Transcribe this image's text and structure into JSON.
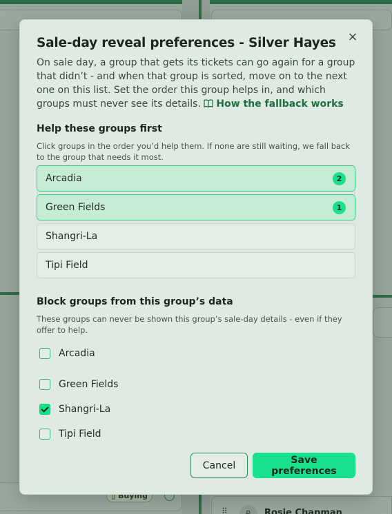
{
  "background": {
    "badge_label": "Buying",
    "person_initial": "R",
    "person_name": "Rosie Chapman"
  },
  "modal": {
    "title": "Sale-day reveal preferences - Silver Hayes",
    "close_label": "×",
    "intro": "On sale day, a group that gets its tickets can go again for a group that didn’t - and when that group is sorted, move on to the next one on this list. Set the order this group helps in, and which groups must never see its details.",
    "intro_link": "How the fallback works"
  },
  "help_section": {
    "title": "Help these groups first",
    "help": "Click groups in the order you’d help them. If none are still waiting, we fall back to the group that needs it most.",
    "options": [
      {
        "label": "Arcadia",
        "selected": true,
        "rank": "2"
      },
      {
        "label": "Green Fields",
        "selected": true,
        "rank": "1"
      },
      {
        "label": "Shangri-La",
        "selected": false,
        "rank": ""
      },
      {
        "label": "Tipi Field",
        "selected": false,
        "rank": ""
      }
    ]
  },
  "block_section": {
    "title": "Block groups from this group’s data",
    "help": "These groups can never be shown this group’s sale-day details - even if they offer to help.",
    "options": [
      {
        "label": "Arcadia",
        "checked": false
      },
      {
        "label": "Green Fields",
        "checked": false
      },
      {
        "label": "Shangri-La",
        "checked": true
      },
      {
        "label": "Tipi Field",
        "checked": false
      }
    ]
  },
  "footer": {
    "cancel_label": "Cancel",
    "save_label": "Save preferences"
  },
  "colors": {
    "accent": "#18e08c",
    "link": "#1f6e43",
    "modal_bg": "#dfebe2",
    "selected_bg": "#c6ecd6"
  }
}
